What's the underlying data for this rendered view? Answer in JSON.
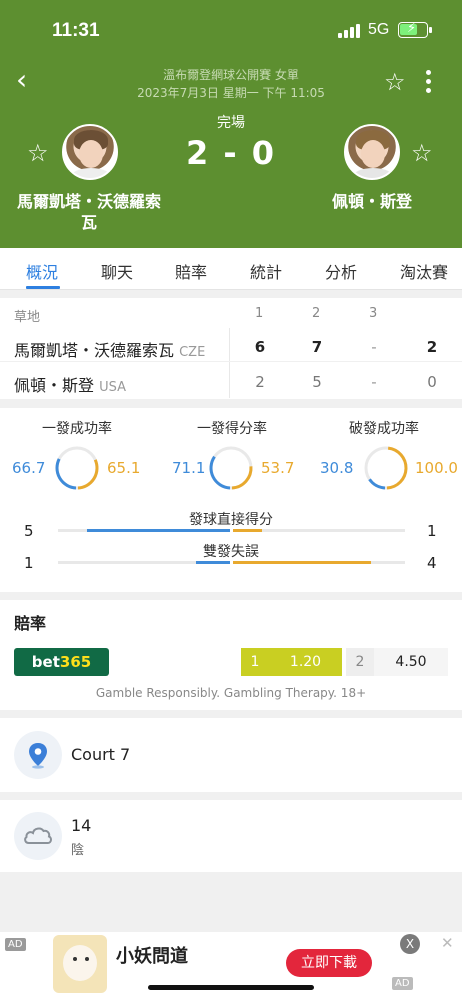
{
  "status_bar": {
    "time": "11:31",
    "network": "5G"
  },
  "header": {
    "tournament": "溫布爾登網球公開賽 女單",
    "datetime": "2023年7月3日 星期一 下午 11:05",
    "match_status": "完場",
    "score": "2 - 0",
    "player1": {
      "name": "馬爾凱塔・沃德羅索瓦"
    },
    "player2": {
      "name": "佩頓・斯登"
    }
  },
  "tabs": [
    "概況",
    "聊天",
    "賠率",
    "統計",
    "分析",
    "淘汰賽"
  ],
  "scoreboard": {
    "surface": "草地",
    "set_headers": [
      "1",
      "2",
      "3"
    ],
    "rows": [
      {
        "name": "馬爾凱塔・沃德羅索瓦",
        "country": "CZE",
        "sets": [
          "6",
          "7",
          "-"
        ],
        "total": "2"
      },
      {
        "name": "佩頓・斯登",
        "country": "USA",
        "sets": [
          "2",
          "5",
          "-"
        ],
        "total": "0"
      }
    ]
  },
  "stats": {
    "rings": [
      {
        "label": "一發成功率",
        "left": "66.7",
        "right": "65.1",
        "left_pct": 66.7,
        "right_pct": 65.1
      },
      {
        "label": "一發得分率",
        "left": "71.1",
        "right": "53.7",
        "left_pct": 71.1,
        "right_pct": 53.7
      },
      {
        "label": "破發成功率",
        "left": "30.8",
        "right": "100.0",
        "left_pct": 30.8,
        "right_pct": 100.0
      }
    ],
    "bars": [
      {
        "label": "發球直接得分",
        "left": "5",
        "right": "1",
        "left_val": 5,
        "right_val": 1
      },
      {
        "label": "雙發失誤",
        "left": "1",
        "right": "4",
        "left_val": 1,
        "right_val": 4
      }
    ],
    "colors": {
      "player1": "#3f8bd9",
      "player2": "#e8a92e"
    }
  },
  "odds": {
    "title": "賠率",
    "bookmaker_a": "bet",
    "bookmaker_b": "365",
    "option1_index": "1",
    "option1_value": "1.20",
    "option2_index": "2",
    "option2_value": "4.50",
    "disclaimer": "Gamble Responsibly. Gambling Therapy. 18+"
  },
  "venue": {
    "icon": "location-pin-icon",
    "name": "Court 7"
  },
  "weather": {
    "icon": "cloud-icon",
    "temperature": "14",
    "condition": "陰"
  },
  "ad": {
    "tag": "AD",
    "title": "小妖問道",
    "cta": "立即下載",
    "close": "X",
    "dismiss": "✕",
    "tag2": "AD"
  }
}
